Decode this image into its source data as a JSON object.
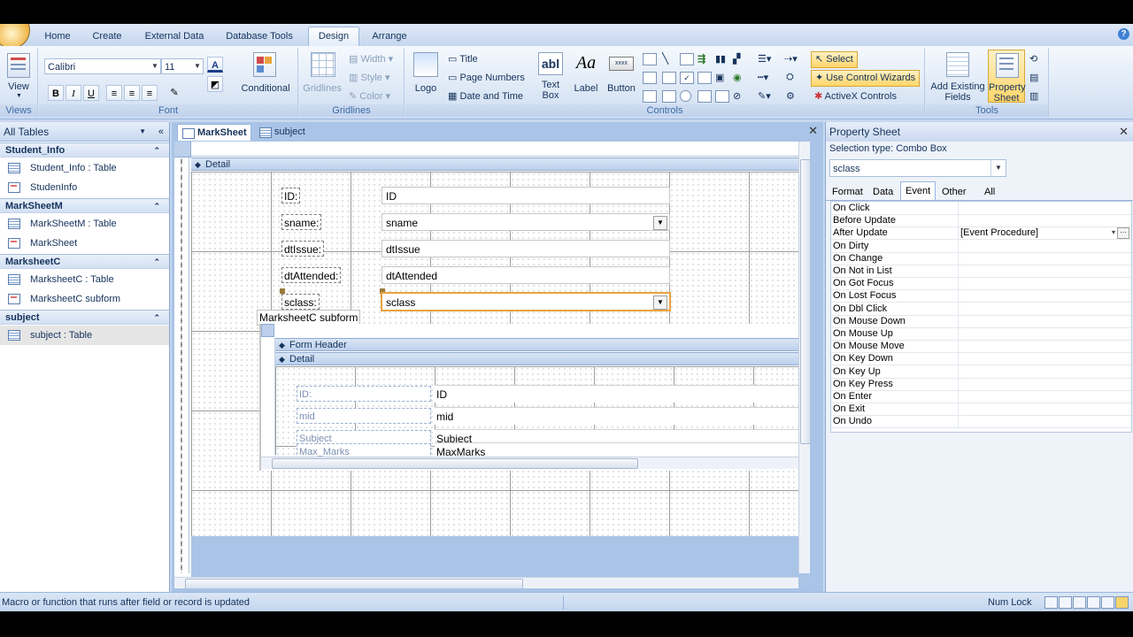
{
  "ribbon": {
    "tabs": [
      "Home",
      "Create",
      "External Data",
      "Database Tools",
      "Design",
      "Arrange"
    ],
    "active_tab": "Design",
    "views": {
      "view_label": "View",
      "group_label": "Views"
    },
    "font": {
      "font_name": "Calibri",
      "font_size": "11",
      "conditional_label": "Conditional",
      "group_label": "Font"
    },
    "gridlines": {
      "gridlines_label": "Gridlines",
      "width_label": "Width",
      "style_label": "Style",
      "color_label": "Color",
      "group_label": "Gridlines"
    },
    "controls": {
      "logo_label": "Logo",
      "title_label": "Title",
      "page_numbers_label": "Page Numbers",
      "date_time_label": "Date and Time",
      "text_box_label_1": "Text",
      "text_box_label_2": "Box",
      "label_label": "Label",
      "button_label": "Button",
      "select_label": "Select",
      "use_wizards_label": "Use Control Wizards",
      "activex_label": "ActiveX Controls",
      "group_label": "Controls"
    },
    "tools": {
      "add_fields_1": "Add Existing",
      "add_fields_2": "Fields",
      "property_sheet_1": "Property",
      "property_sheet_2": "Sheet",
      "group_label": "Tools"
    }
  },
  "nav": {
    "title": "All Tables",
    "groups": [
      {
        "name": "Student_Info",
        "items": [
          {
            "label": "Student_Info : Table",
            "icon": "table-icon"
          },
          {
            "label": "StudenInfo",
            "icon": "form-icon"
          }
        ]
      },
      {
        "name": "MarkSheetM",
        "items": [
          {
            "label": "MarkSheetM : Table",
            "icon": "table-icon"
          },
          {
            "label": "MarkSheet",
            "icon": "form-icon"
          }
        ]
      },
      {
        "name": "MarksheetC",
        "items": [
          {
            "label": "MarksheetC : Table",
            "icon": "table-icon"
          },
          {
            "label": "MarksheetC subform",
            "icon": "form-icon"
          }
        ]
      },
      {
        "name": "subject",
        "items": [
          {
            "label": "subject : Table",
            "icon": "table-icon"
          }
        ]
      }
    ]
  },
  "doc": {
    "tabs": [
      {
        "label": "MarkSheet",
        "active": true
      },
      {
        "label": "subject",
        "active": false
      }
    ],
    "detail_label": "Detail",
    "fields": [
      {
        "label": "ID:",
        "value": "ID",
        "combo": false
      },
      {
        "label": "sname:",
        "value": "sname",
        "combo": true
      },
      {
        "label": "dtIssue:",
        "value": "dtIssue",
        "combo": false
      },
      {
        "label": "dtAttended:",
        "value": "dtAttended",
        "combo": false
      },
      {
        "label": "sclass:",
        "value": "sclass",
        "combo": true,
        "selected": true
      }
    ],
    "subform": {
      "label": "MarksheetC subform",
      "form_header_label": "Form Header",
      "detail_label": "Detail",
      "fields": [
        {
          "label": "ID:",
          "value": "ID"
        },
        {
          "label": "mid",
          "value": "mid"
        },
        {
          "label": "Subject",
          "value": "Subject"
        },
        {
          "label": "Max_Marks",
          "value": "MaxMarks"
        }
      ]
    }
  },
  "property_sheet": {
    "title": "Property Sheet",
    "selection_type": "Selection type:  Combo Box",
    "selected_object": "sclass",
    "tabs": [
      "Format",
      "Data",
      "Event",
      "Other",
      "All"
    ],
    "active_tab": "Event",
    "rows": [
      {
        "name": "On Click",
        "value": ""
      },
      {
        "name": "Before Update",
        "value": ""
      },
      {
        "name": "After Update",
        "value": "[Event Procedure]"
      },
      {
        "name": "On Dirty",
        "value": ""
      },
      {
        "name": "On Change",
        "value": ""
      },
      {
        "name": "On Not in List",
        "value": ""
      },
      {
        "name": "On Got Focus",
        "value": ""
      },
      {
        "name": "On Lost Focus",
        "value": ""
      },
      {
        "name": "On Dbl Click",
        "value": ""
      },
      {
        "name": "On Mouse Down",
        "value": ""
      },
      {
        "name": "On Mouse Up",
        "value": ""
      },
      {
        "name": "On Mouse Move",
        "value": ""
      },
      {
        "name": "On Key Down",
        "value": ""
      },
      {
        "name": "On Key Up",
        "value": ""
      },
      {
        "name": "On Key Press",
        "value": ""
      },
      {
        "name": "On Enter",
        "value": ""
      },
      {
        "name": "On Exit",
        "value": ""
      },
      {
        "name": "On Undo",
        "value": ""
      }
    ]
  },
  "status": {
    "message": "Macro or function that runs after field or record is updated",
    "num_lock": "Num Lock"
  },
  "colors": {
    "accent_selection": "#e8a33d",
    "ribbon_blue": "#c7d7ee",
    "highlight": "#ffd569"
  }
}
